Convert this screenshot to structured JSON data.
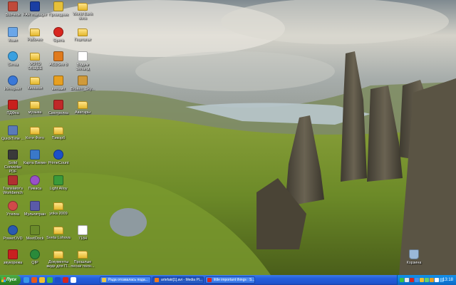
{
  "desktop_icons": [
    {
      "label": "Волчеок",
      "color": "#c04a3a",
      "kind": "app"
    },
    {
      "label": "FAR manager",
      "color": "#1b3fa3",
      "kind": "app"
    },
    {
      "label": "Проводник",
      "color": "#e6c03a",
      "kind": "app"
    },
    {
      "label": "World Bank docs",
      "color": "#e4b92e",
      "kind": "folder"
    },
    {
      "label": "Комп",
      "color": "#6aa6e8",
      "kind": "app"
    },
    {
      "label": "Рабочее",
      "color": "#e4b92e",
      "kind": "folder"
    },
    {
      "label": "Opera",
      "color": "#d8261f",
      "kind": "app"
    },
    {
      "label": "Гештальт",
      "color": "#e4b92e",
      "kind": "folder"
    },
    {
      "label": "Сетка",
      "color": "#3aa0e0",
      "kind": "app"
    },
    {
      "label": "ФОТО ОБЩЕЕ",
      "color": "#e4b92e",
      "kind": "folder"
    },
    {
      "label": "ACDSee 8",
      "color": "#e07a1c",
      "kind": "app"
    },
    {
      "label": "Вадим Зеланд",
      "color": "#ffffff",
      "kind": "app"
    },
    {
      "label": "Интернет",
      "color": "#3a78d8",
      "kind": "app"
    },
    {
      "label": "Кинохоп",
      "color": "#e4b92e",
      "kind": "folder"
    },
    {
      "label": "винамп",
      "color": "#e8a020",
      "kind": "app"
    },
    {
      "label": "Broken_Sky...",
      "color": "#d09a3a",
      "kind": "app"
    },
    {
      "label": "ПДФка",
      "color": "#c8201c",
      "kind": "app"
    },
    {
      "label": "музыка",
      "color": "#e4b92e",
      "kind": "folder"
    },
    {
      "label": "Смотрелка",
      "color": "#c02828",
      "kind": "app"
    },
    {
      "label": "Аватары",
      "color": "#e4b92e",
      "kind": "folder"
    },
    {
      "label": "QuickTime ...",
      "color": "#5a7ab8",
      "kind": "app"
    },
    {
      "label": "Коти Фото",
      "color": "#e4b92e",
      "kind": "folder"
    },
    {
      "label": "Пикорб",
      "color": "#e4b92e",
      "kind": "folder"
    },
    {
      "label": "Solid Converter PDF",
      "color": "#3a3a3a",
      "kind": "app"
    },
    {
      "label": "Карта Вилин",
      "color": "#3a78c8",
      "kind": "app"
    },
    {
      "label": "PrimeCount",
      "color": "#1c50c8",
      "kind": "app"
    },
    {
      "label": "Translator's Workbench",
      "color": "#b03030",
      "kind": "app"
    },
    {
      "label": "Пикаса",
      "color": "#9a50c8",
      "kind": "app"
    },
    {
      "label": "Light Alloy",
      "color": "#3a9a3a",
      "kind": "app"
    },
    {
      "label": "Утилка",
      "color": "#d04a4a",
      "kind": "app"
    },
    {
      "label": "Мультитран",
      "color": "#5a5aa8",
      "kind": "app"
    },
    {
      "label": "yoka 2009",
      "color": "#e4b92e",
      "kind": "folder"
    },
    {
      "label": "PowerDVD",
      "color": "#2a5ab0",
      "kind": "app"
    },
    {
      "label": "MeetDock",
      "color": "#6a8a2a",
      "kind": "app"
    },
    {
      "label": "Sveta Lohova",
      "color": "#e4b92e",
      "kind": "folder"
    },
    {
      "label": "7184",
      "color": "#ffffff",
      "kind": "app"
    },
    {
      "label": "звукорежа",
      "color": "#c82020",
      "kind": "app"
    },
    {
      "label": "QIP",
      "color": "#2a8a3a",
      "kind": "app"
    },
    {
      "label": "Документы виде для П...",
      "color": "#e4b92e",
      "kind": "folder"
    },
    {
      "label": "Прошлые песни полн...",
      "color": "#e4b92e",
      "kind": "folder"
    },
    {
      "label": "Корзина",
      "color": "#9ab8d8",
      "kind": "app"
    }
  ],
  "taskbar": {
    "start_label": "Пуск",
    "tasks": [
      {
        "label": "Рада отозвалась пода...",
        "color": "#e8c848",
        "active": false
      },
      {
        "label": "artefakt[1].avi - Media Pl...",
        "color": "#f07a1c",
        "active": true
      },
      {
        "label": "little important things : S...",
        "color": "#d8261f",
        "active": false
      }
    ],
    "quick_launch": [
      "#3a9ae8",
      "#e85a1c",
      "#f0c030",
      "#4ab840",
      "#1c50c8",
      "#d8261f",
      "#ffffff"
    ],
    "tray_icons": [
      "#3ac040",
      "#e8e8e8",
      "#d8261f",
      "#4a90e8",
      "#f0c030",
      "#6ad06a",
      "#e8a020",
      "#ffffff",
      "#5ab0f0"
    ],
    "clock": "13:18"
  }
}
